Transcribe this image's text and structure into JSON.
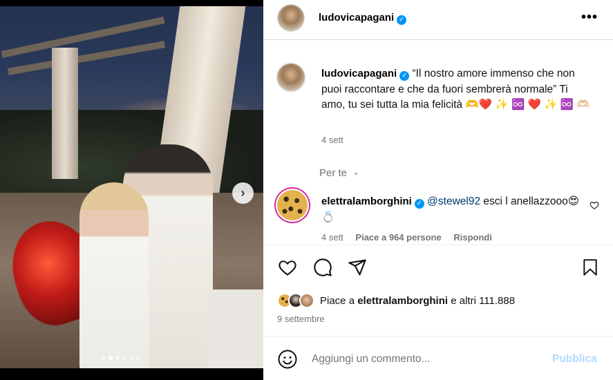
{
  "post": {
    "author": "ludovicapagani",
    "more_icon": "•••",
    "next_icon": "›",
    "carousel": {
      "count": 6,
      "active_index": 1
    }
  },
  "caption": {
    "author": "ludovicapagani",
    "text": "“Il nostro amore immenso che non puoi raccontare e che da fuori sembrerà normale” Ti amo, tu sei tutta la mia felicità 🫶❤️ ✨ ♾️ ❤️ ✨ ♾️ 🫶🏻",
    "time": "4 sett"
  },
  "for_you": {
    "label": "Per te",
    "icon": "⌄"
  },
  "comment": {
    "author": "elettralamborghini",
    "mention": "@stewel92",
    "text": " esci l anellazzooo😍 💍",
    "time": "4 sett",
    "likes": "Piace a 964 persone",
    "reply": "Rispondi"
  },
  "likes": {
    "prefix": "Piace a ",
    "user": "elettralamborghini",
    "suffix": " e altri 111.888"
  },
  "date": "9 settembre",
  "composer": {
    "placeholder": "Aggiungi un commento...",
    "publish": "Pubblica"
  },
  "colors": {
    "verified": "#0095f6",
    "publish_disabled": "#b3dbff",
    "secondary_text": "#737373",
    "mention": "#00376b"
  }
}
